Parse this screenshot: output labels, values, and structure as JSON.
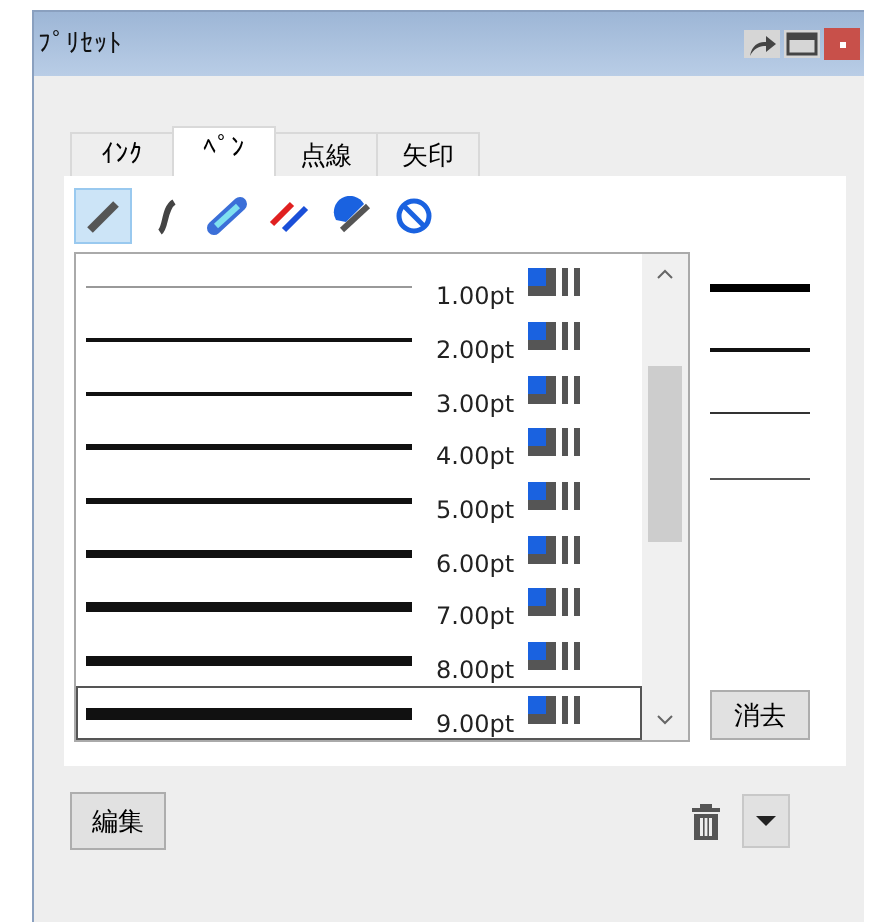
{
  "window": {
    "title": "ﾌﾟﾘｾｯﾄ"
  },
  "tabs": [
    {
      "label": "ｲﾝｸ",
      "selected": false
    },
    {
      "label": "ﾍﾟﾝ",
      "selected": true
    },
    {
      "label": "点線",
      "selected": false
    },
    {
      "label": "矢印",
      "selected": false
    }
  ],
  "tools": [
    {
      "kind": "pen",
      "selected": true
    },
    {
      "kind": "curve",
      "selected": false
    },
    {
      "kind": "highlighter",
      "selected": false
    },
    {
      "kind": "double",
      "selected": false
    },
    {
      "kind": "brush",
      "selected": false
    },
    {
      "kind": "none",
      "selected": false
    }
  ],
  "presets": [
    {
      "label": "1.00pt",
      "selected": false
    },
    {
      "label": "2.00pt",
      "selected": false
    },
    {
      "label": "3.00pt",
      "selected": false
    },
    {
      "label": "4.00pt",
      "selected": false
    },
    {
      "label": "5.00pt",
      "selected": false
    },
    {
      "label": "6.00pt",
      "selected": false
    },
    {
      "label": "7.00pt",
      "selected": false
    },
    {
      "label": "8.00pt",
      "selected": false
    },
    {
      "label": "9.00pt",
      "selected": true
    }
  ],
  "clear_button": "消去",
  "edit_button": "編集"
}
